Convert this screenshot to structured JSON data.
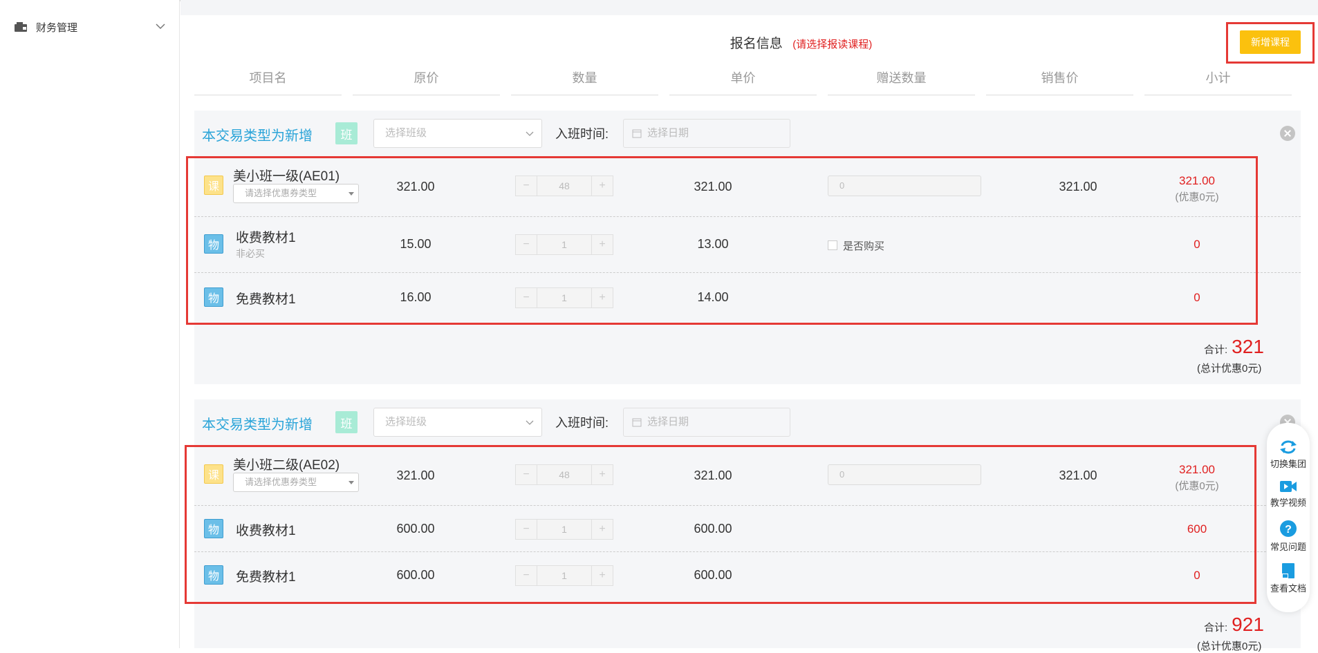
{
  "sidebar": {
    "items": [
      {
        "label": "财务管理",
        "icon": "wallet-icon"
      }
    ]
  },
  "form": {
    "title": "报名信息",
    "title_note": "(请选择报读课程)",
    "add_button": "新增课程",
    "headers": [
      "项目名",
      "原价",
      "数量",
      "单价",
      "赠送数量",
      "销售价",
      "小计"
    ]
  },
  "groups": [
    {
      "type_label": "本交易类型为新增",
      "class_badge": "班",
      "class_select_placeholder": "选择班级",
      "enter_label": "入班时间:",
      "date_placeholder": "选择日期",
      "rows": [
        {
          "badge": "课",
          "name": "美小班一级(AE01)",
          "coupon_placeholder": "请选择优惠券类型",
          "price": "321.00",
          "qty": "48",
          "unit": "321.00",
          "gift_value": "0",
          "sale": "321.00",
          "subtotal": "321.00",
          "sub_note": "(优惠0元)"
        },
        {
          "badge": "物",
          "name": "收费教材1",
          "sub": "非必买",
          "price": "15.00",
          "qty": "1",
          "unit": "13.00",
          "buy_label": "是否购买",
          "subtotal": "0"
        },
        {
          "badge": "物",
          "name": "免费教材1",
          "price": "16.00",
          "qty": "1",
          "unit": "14.00",
          "subtotal": "0"
        }
      ],
      "total_label": "合计:",
      "total_value": "321",
      "total_note": "(总计优惠0元)"
    },
    {
      "type_label": "本交易类型为新增",
      "class_badge": "班",
      "class_select_placeholder": "选择班级",
      "enter_label": "入班时间:",
      "date_placeholder": "选择日期",
      "rows": [
        {
          "badge": "课",
          "name": "美小班二级(AE02)",
          "coupon_placeholder": "请选择优惠券类型",
          "price": "321.00",
          "qty": "48",
          "unit": "321.00",
          "gift_value": "0",
          "sale": "321.00",
          "subtotal": "321.00",
          "sub_note": "(优惠0元)"
        },
        {
          "badge": "物",
          "name": "收费教材1",
          "price": "600.00",
          "qty": "1",
          "unit": "600.00",
          "subtotal": "600"
        },
        {
          "badge": "物",
          "name": "免费教材1",
          "price": "600.00",
          "qty": "1",
          "unit": "600.00",
          "subtotal": "0"
        }
      ],
      "total_label": "合计:",
      "total_value": "921",
      "total_note": "(总计优惠0元)"
    }
  ],
  "tools": [
    {
      "label": "切换集团",
      "icon": "switch-icon"
    },
    {
      "label": "教学视频",
      "icon": "video-icon"
    },
    {
      "label": "常见问题",
      "icon": "question-icon"
    },
    {
      "label": "查看文档",
      "icon": "document-icon"
    }
  ],
  "colors": {
    "accent": "#2aa4d8",
    "button": "#fbc10e",
    "warning": "#e02020",
    "highlight_box": "#e53935"
  }
}
